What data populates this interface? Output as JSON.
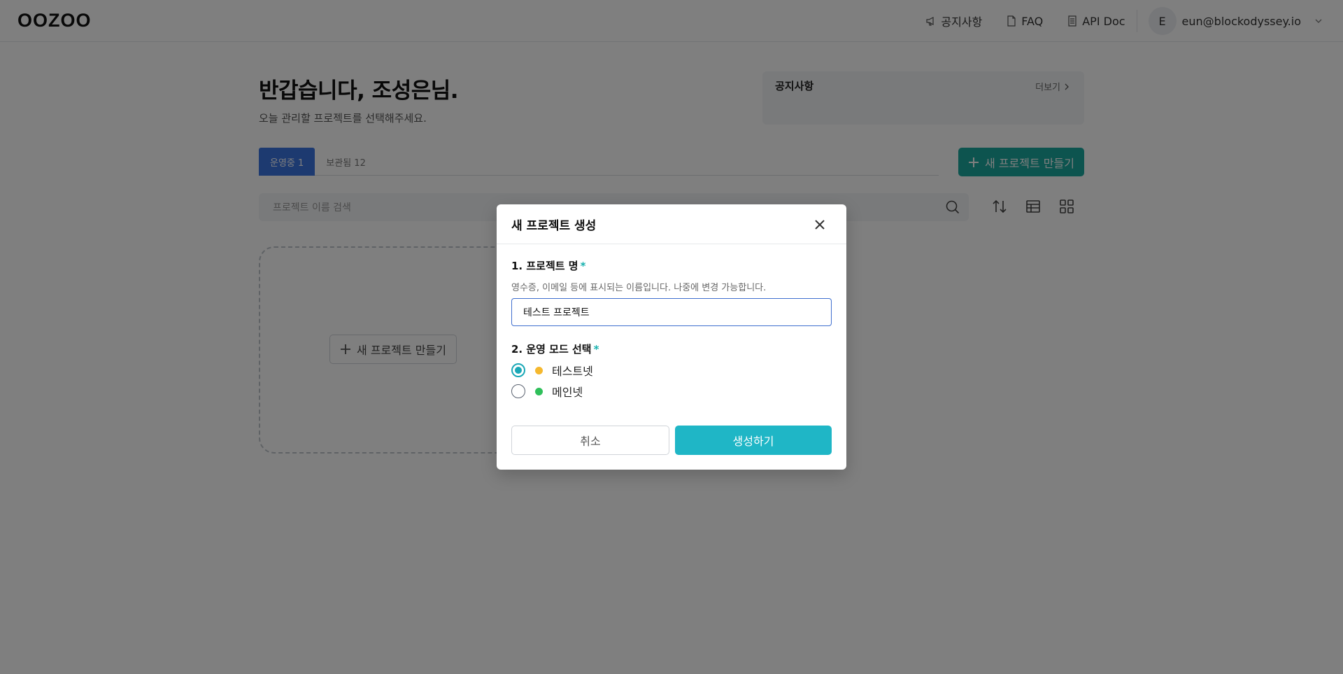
{
  "header": {
    "logo": "OOZOO",
    "nav": [
      {
        "label": "공지사항",
        "icon": "megaphone-icon"
      },
      {
        "label": "FAQ",
        "icon": "document-icon"
      },
      {
        "label": "API Doc",
        "icon": "document-list-icon"
      }
    ],
    "user": {
      "initial": "E",
      "email": "eun@blockodyssey.io"
    }
  },
  "main": {
    "greeting": "반갑습니다, 조성은님.",
    "subtitle": "오늘 관리할 프로젝트를 선택해주세요.",
    "notice": {
      "title": "공지사항",
      "more": "더보기"
    },
    "tabs": [
      {
        "label": "운영중 1",
        "active": true
      },
      {
        "label": "보관됨 12",
        "active": false
      }
    ],
    "new_project_button": "새 프로젝트 만들기",
    "search_placeholder": "프로젝트 이름 검색",
    "empty_card_button": "새 프로젝트 만들기"
  },
  "modal": {
    "title": "새 프로젝트 생성",
    "field1": {
      "label": "1. 프로젝트 명",
      "required_mark": "*",
      "help": "영수증, 이메일 등에 표시되는 이름입니다. 나중에 변경 가능합니다.",
      "value": "테스트 프로젝트"
    },
    "field2": {
      "label": "2. 운영 모드 선택",
      "required_mark": "*",
      "options": [
        {
          "label": "테스트넷",
          "checked": true,
          "dot_color": "#f5b82e"
        },
        {
          "label": "메인넷",
          "checked": false,
          "dot_color": "#2fbf5a"
        }
      ]
    },
    "cancel": "취소",
    "create": "생성하기"
  },
  "colors": {
    "accent": "#1fb6c6",
    "tab_active": "#3b74e0",
    "new_button": "#1aa89f"
  }
}
